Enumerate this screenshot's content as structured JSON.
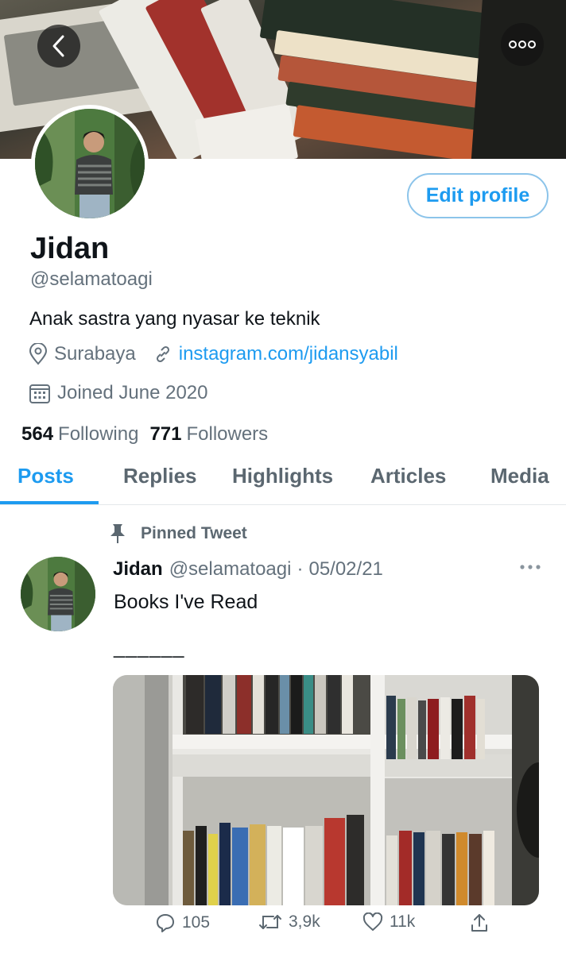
{
  "header": {
    "back_icon": "chevron-left-icon",
    "more_icon": "more-horizontal-icon"
  },
  "profile": {
    "edit_label": "Edit profile",
    "name": "Jidan",
    "handle": "@selamatoagi",
    "bio": "Anak sastra yang nyasar ke teknik",
    "location": "Surabaya",
    "website": "instagram.com/jidansyabil",
    "joined": "Joined June 2020",
    "following_count": "564",
    "following_label": "Following",
    "followers_count": "771",
    "followers_label": "Followers"
  },
  "tabs": [
    {
      "label": "Posts",
      "active": true
    },
    {
      "label": "Replies",
      "active": false
    },
    {
      "label": "Highlights",
      "active": false
    },
    {
      "label": "Articles",
      "active": false
    },
    {
      "label": "Media",
      "active": false
    }
  ],
  "tweet": {
    "pinned_label": "Pinned Tweet",
    "author_name": "Jidan",
    "author_handle": "@selamatoagi",
    "separator": "·",
    "date": "05/02/21",
    "text": "Books I've Read",
    "divider_text": "______",
    "reply_count": "105",
    "retweet_count": "3,9k",
    "like_count": "11k"
  },
  "colors": {
    "accent": "#1d9bf0",
    "secondary_text": "#64717c",
    "primary_text": "#0f1419"
  }
}
